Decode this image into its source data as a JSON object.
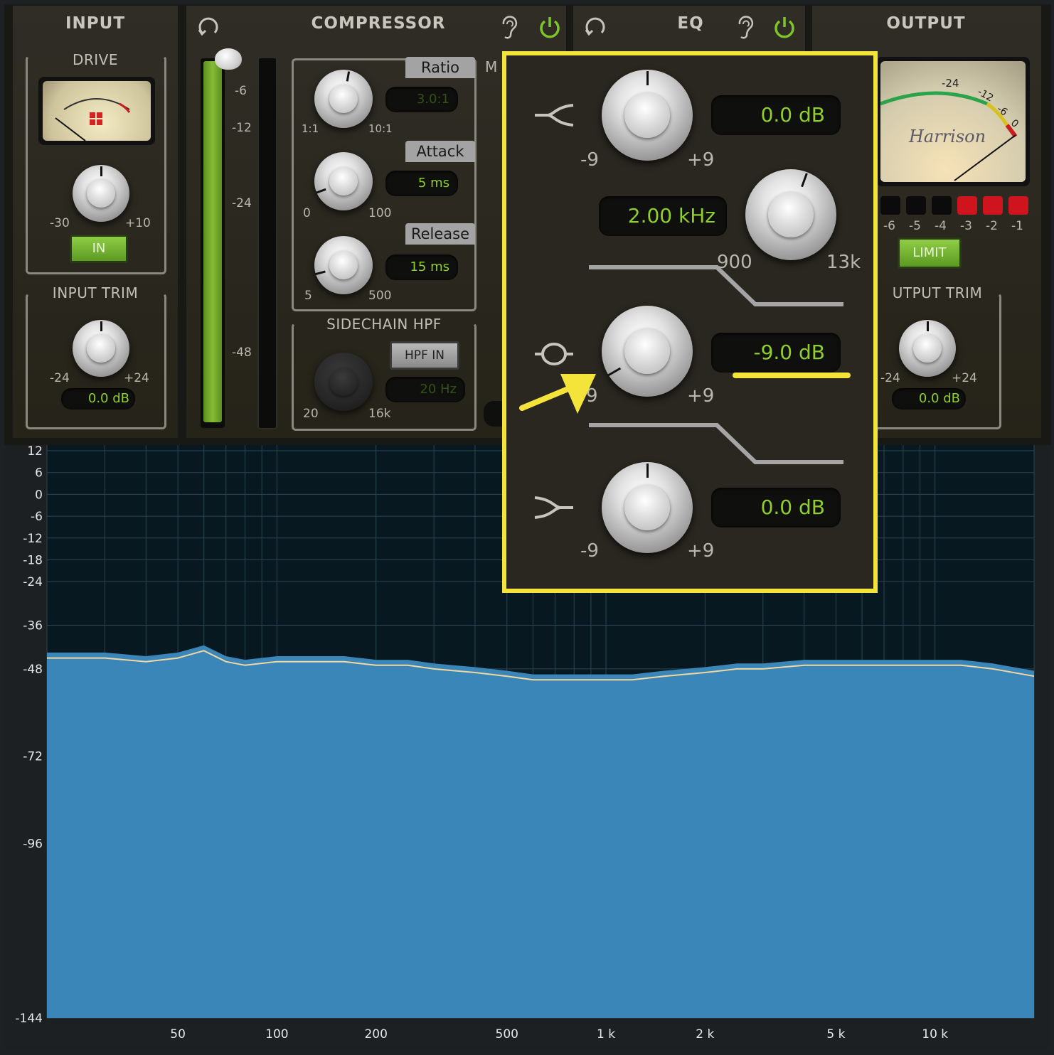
{
  "input": {
    "title": "INPUT",
    "drive_label": "DRIVE",
    "drive_min": "-30",
    "drive_max": "+10",
    "in_button": "IN",
    "trim_label": "INPUT TRIM",
    "trim_min": "-24",
    "trim_max": "+24",
    "trim_value": "0.0 dB"
  },
  "compressor": {
    "title": "COMPRESSOR",
    "meter_scale": [
      "-6",
      "-12",
      "-24",
      "-48"
    ],
    "ratio_label": "Ratio",
    "ratio_value": "3.0:1",
    "ratio_min": "1:1",
    "ratio_max": "10:1",
    "attack_label": "Attack",
    "attack_value": "5 ms",
    "attack_min": "0",
    "attack_max": "100",
    "release_label": "Release",
    "release_value": "15 ms",
    "release_min": "5",
    "release_max": "500",
    "sidechain_label": "SIDECHAIN HPF",
    "hpf_button": "HPF IN",
    "hpf_value": "20 Hz",
    "hpf_min": "20",
    "hpf_max": "16k",
    "makeup_partial": "M"
  },
  "eq": {
    "title": "EQ",
    "high": {
      "value": "0.0 dB",
      "min": "-9",
      "max": "+9"
    },
    "freq": {
      "value": "2.00 kHz",
      "min": "900",
      "max": "13k"
    },
    "mid": {
      "value": "-9.0 dB",
      "min": "9",
      "max": "+9"
    },
    "low": {
      "value": "0.0 dB",
      "min": "-9",
      "max": "+9"
    }
  },
  "output": {
    "title": "OUTPUT",
    "vu_scale": [
      "-24",
      "-12",
      "-6",
      "0"
    ],
    "brand": "Harrison",
    "leds": [
      "-6",
      "-5",
      "-4",
      "-3",
      "-2",
      "-1"
    ],
    "limit_button": "LIMIT",
    "trim_label": "OUTPUT TRIM",
    "trim_label_visible": "UTPUT TRIM",
    "trim_min": "-24",
    "trim_max": "+24",
    "trim_value": "0.0 dB"
  },
  "colors": {
    "accent_green": "#8fcf2a",
    "annotation_yellow": "#f4e43a",
    "spectrum_fill": "#3a86b8",
    "spectrum_bg": "#071820",
    "led_red": "#d0141e"
  },
  "chart_data": {
    "type": "area",
    "title": "",
    "xlabel": "",
    "ylabel": "",
    "x_scale": "log",
    "xlim": [
      20,
      20000
    ],
    "ylim": [
      -144,
      12
    ],
    "x_ticks": [
      "50",
      "100",
      "200",
      "500",
      "1 k",
      "2 k",
      "5 k",
      "10 k"
    ],
    "x_tick_values": [
      50,
      100,
      200,
      500,
      1000,
      2000,
      5000,
      10000
    ],
    "y_ticks": [
      "12",
      "6",
      "0",
      "-6",
      "-12",
      "-18",
      "-24",
      "-36",
      "-48",
      "-72",
      "-96",
      "-144"
    ],
    "y_tick_values": [
      12,
      6,
      0,
      -6,
      -12,
      -18,
      -24,
      -36,
      -48,
      -72,
      -96,
      -144
    ],
    "series": [
      {
        "x": [
          20,
          30,
          40,
          50,
          60,
          70,
          80,
          100,
          130,
          160,
          200,
          250,
          300,
          400,
          500,
          600,
          800,
          1000,
          1200,
          1500,
          2000,
          2500,
          3000,
          4000,
          5000,
          6000,
          8000,
          10000,
          12000,
          15000,
          20000
        ],
        "values": [
          -45,
          -45,
          -46,
          -45,
          -43,
          -46,
          -47,
          -46,
          -46,
          -46,
          -47,
          -47,
          -48,
          -49,
          -50,
          -51,
          -51,
          -51,
          -51,
          -50,
          -49,
          -48,
          -48,
          -47,
          -47,
          -47,
          -47,
          -47,
          -47,
          -48,
          -50
        ]
      }
    ],
    "grid": true
  }
}
